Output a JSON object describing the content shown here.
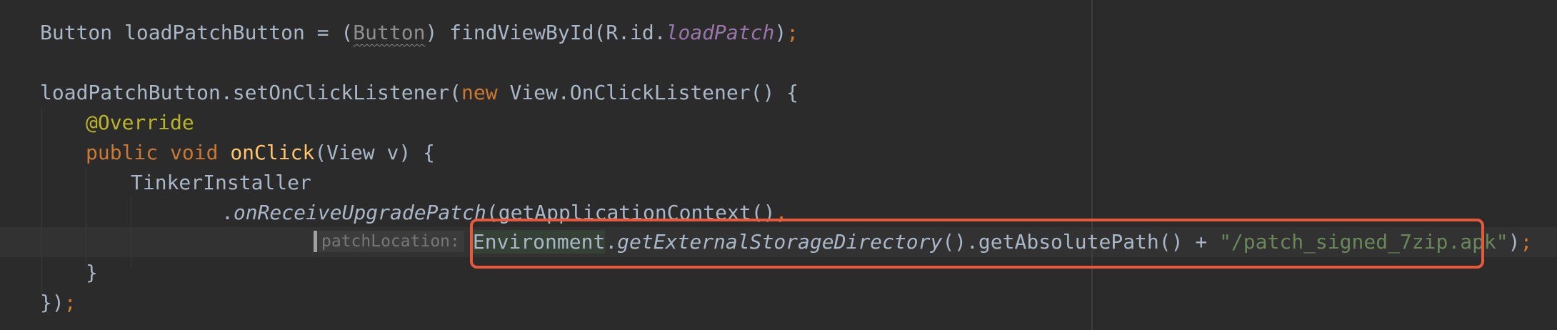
{
  "code": {
    "line1": {
      "type_decl": "Button loadPatchButton = (",
      "cast": "Button",
      "call": ") findViewById(R.id.",
      "field": "loadPatch",
      "close": ")",
      "semi": ";"
    },
    "line2": {
      "receiver": "loadPatchButton.setOnClickListener(",
      "kw_new": "new",
      "anon_type": " View.OnClickListener() {"
    },
    "line3": {
      "annotation": "@Override"
    },
    "line4": {
      "kw_public": "public",
      "kw_void": " void ",
      "method_name": "onClick",
      "params": "(View v) {"
    },
    "line5": {
      "text": "TinkerInstaller"
    },
    "line6": {
      "dot": ".",
      "static_method": "onReceiveUpgradePatch",
      "rest": "(getApplicationContext()",
      "comma": ","
    },
    "line7": {
      "param_hint": "patchLocation:",
      "env_class": "Environment",
      "dot": ".",
      "static_method": "getExternalStorageDirectory",
      "rest": "().getAbsolutePath() + ",
      "string_literal": "\"/patch_signed_7zip.apk\"",
      "close": ")",
      "semi": ";"
    },
    "line8": {
      "text": "}"
    },
    "line9": {
      "brace": "})",
      "semi": ";"
    }
  },
  "colors": {
    "background": "#2b2b2b",
    "default_text": "#a9b7c6",
    "keyword": "#cc7832",
    "method_decl": "#ffc66d",
    "annotation": "#bbb529",
    "field": "#9876aa",
    "string": "#6a8759",
    "highlight_box": "#e65a3b"
  }
}
